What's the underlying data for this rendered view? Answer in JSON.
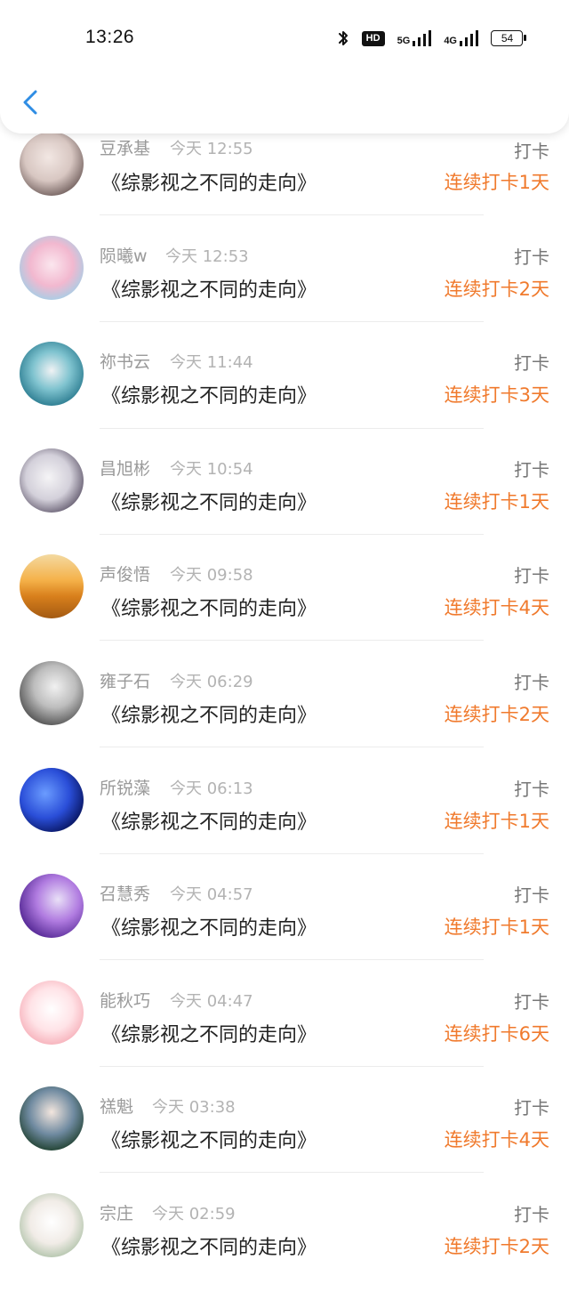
{
  "status_bar": {
    "time": "13:26",
    "hd": "HD",
    "net1": "5G",
    "net2": "4G",
    "battery": "54"
  },
  "feed": [
    {
      "name": "豆承基",
      "time": "今天 12:55",
      "book": "《综影视之不同的走向》",
      "tag": "打卡",
      "streak": "连续打卡1天"
    },
    {
      "name": "陨曦w",
      "time": "今天 12:53",
      "book": "《综影视之不同的走向》",
      "tag": "打卡",
      "streak": "连续打卡2天"
    },
    {
      "name": "祢书云",
      "time": "今天 11:44",
      "book": "《综影视之不同的走向》",
      "tag": "打卡",
      "streak": "连续打卡3天"
    },
    {
      "name": "昌旭彬",
      "time": "今天 10:54",
      "book": "《综影视之不同的走向》",
      "tag": "打卡",
      "streak": "连续打卡1天"
    },
    {
      "name": "声俊悟",
      "time": "今天 09:58",
      "book": "《综影视之不同的走向》",
      "tag": "打卡",
      "streak": "连续打卡4天"
    },
    {
      "name": "雍子石",
      "time": "今天 06:29",
      "book": "《综影视之不同的走向》",
      "tag": "打卡",
      "streak": "连续打卡2天"
    },
    {
      "name": "所锐藻",
      "time": "今天 06:13",
      "book": "《综影视之不同的走向》",
      "tag": "打卡",
      "streak": "连续打卡1天"
    },
    {
      "name": "召慧秀",
      "time": "今天 04:57",
      "book": "《综影视之不同的走向》",
      "tag": "打卡",
      "streak": "连续打卡1天"
    },
    {
      "name": "能秋巧",
      "time": "今天 04:47",
      "book": "《综影视之不同的走向》",
      "tag": "打卡",
      "streak": "连续打卡6天"
    },
    {
      "name": "禚魁",
      "time": "今天 03:38",
      "book": "《综影视之不同的走向》",
      "tag": "打卡",
      "streak": "连续打卡4天"
    },
    {
      "name": "宗庄",
      "time": "今天 02:59",
      "book": "《综影视之不同的走向》",
      "tag": "打卡",
      "streak": "连续打卡2天"
    }
  ],
  "colors": {
    "accent": "#f07a2d",
    "back_icon": "#2f8de4",
    "muted": "#9a9a9a"
  }
}
